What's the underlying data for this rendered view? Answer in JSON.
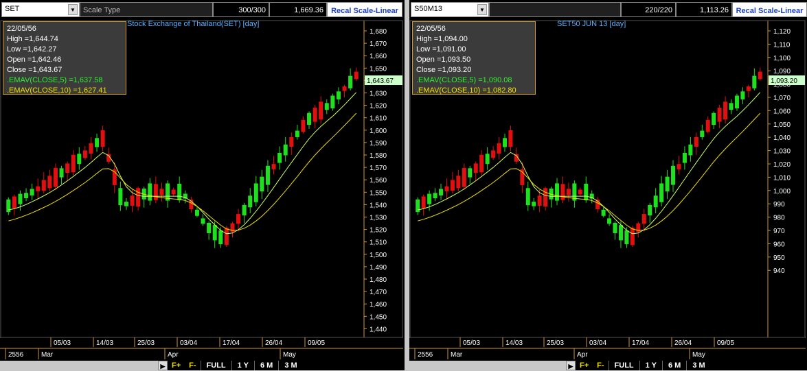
{
  "panels": [
    {
      "symbol": "SET",
      "scale_type": "Scale Type",
      "bars": "300/300",
      "price": "1,669.36",
      "recal": "Recal Scale-Linear",
      "title": "Stock Exchange of Thailand(SET) [day]",
      "info": {
        "date": "22/05/56",
        "high": "High  =1,644.74",
        "low": "Low  =1,642.27",
        "open": "Open  =1,642.46",
        "close": "Close  =1,643.67",
        "ema5": ".EMAV(CLOSE,5)   =1,637.58",
        "ema10": ".EMAV(CLOSE,10)   =1,627.41"
      },
      "yticks": [
        "1,680",
        "1,670",
        "1,660",
        "1,650",
        "1,640",
        "1,630",
        "1,620",
        "1,610",
        "1,600",
        "1,590",
        "1,580",
        "1,570",
        "1,560",
        "1,550",
        "1,540",
        "1,530",
        "1,520",
        "1,510",
        "1,500",
        "1,490",
        "1,480",
        "1,470",
        "1,460",
        "1,450",
        "1,440"
      ],
      "last_label": "1,643.67",
      "xdates": [
        "05/03",
        "14/03",
        "25/03",
        "03/04",
        "17/04",
        "26/04",
        "09/05"
      ],
      "months": [
        "2556",
        "Mar",
        "Apr",
        "May"
      ]
    },
    {
      "symbol": "S50M13",
      "scale_type": "",
      "bars": "220/220",
      "price": "1,113.26",
      "recal": "Recal Scale-Linear",
      "title": "SET50 JUN 13   [day]",
      "info": {
        "date": "22/05/56",
        "high": "High  =1,094.00",
        "low": "Low  =1,091.00",
        "open": "Open  =1,093.50",
        "close": "Close  =1,093.20",
        "ema5": ".EMAV(CLOSE,5)   =1,090.08",
        "ema10": ".EMAV(CLOSE,10)   =1,082.80"
      },
      "yticks": [
        "1,120",
        "1,110",
        "1,100",
        "1,090",
        "1,080",
        "1,070",
        "1,060",
        "1,050",
        "1,040",
        "1,030",
        "1,020",
        "1,010",
        "1,000",
        "990",
        "980",
        "970",
        "960",
        "950",
        "940"
      ],
      "last_label": "1,093.20",
      "xdates": [
        "05/03",
        "14/03",
        "25/03",
        "03/04",
        "17/04",
        "26/04",
        "09/05"
      ],
      "months": [
        "2556",
        "Mar",
        "Apr",
        "May"
      ]
    }
  ],
  "buttons": {
    "fplus": "F+",
    "fminus": "F-",
    "full": "FULL",
    "y1": "1 Y",
    "m6": "6 M",
    "m3": "3 M"
  },
  "colors": {
    "up": "#1fe01f",
    "down": "#e01010",
    "ema5": "#ccff66",
    "ema10": "#f0e000",
    "axis": "#d09a2a"
  },
  "chart_data": [
    {
      "type": "candlestick",
      "title": "Stock Exchange of Thailand(SET) [day]",
      "ylim": [
        1440,
        1680
      ],
      "series": [
        {
          "name": ".EMAV(CLOSE,5)",
          "last": 1637.58
        },
        {
          "name": ".EMAV(CLOSE,10)",
          "last": 1627.41
        }
      ],
      "last_close": 1643.67
    },
    {
      "type": "candlestick",
      "title": "SET50 JUN 13 [day]",
      "ylim": [
        940,
        1120
      ],
      "series": [
        {
          "name": ".EMAV(CLOSE,5)",
          "last": 1090.08
        },
        {
          "name": ".EMAV(CLOSE,10)",
          "last": 1082.8
        }
      ],
      "last_close": 1093.2
    }
  ]
}
